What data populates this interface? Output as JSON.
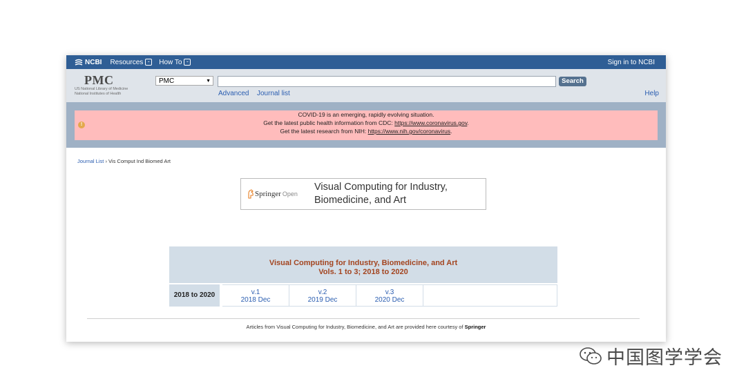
{
  "ncbi_bar": {
    "logo": "NCBI",
    "resources": "Resources",
    "howto": "How To",
    "signin": "Sign in to NCBI"
  },
  "header": {
    "logo": "PMC",
    "nlm_line1": "US National Library of Medicine",
    "nlm_line2": "National Institutes of Health",
    "db_selected": "PMC",
    "search_button": "Search",
    "advanced": "Advanced",
    "journal_list": "Journal list",
    "help": "Help"
  },
  "alert": {
    "line1": "COVID-19 is an emerging, rapidly evolving situation.",
    "line2_prefix": "Get the latest public health information from CDC:",
    "line2_link": "https://www.coronavirus.gov",
    "line2_suffix": ".",
    "line3_prefix": "Get the latest research from NIH:",
    "line3_link": "https://www.nih.gov/coronavirus",
    "line3_suffix": "."
  },
  "breadcrumb": {
    "root": "Journal List",
    "sep": "›",
    "current": "Vis Comput Ind Biomed Art"
  },
  "banner": {
    "publisher": "Springer",
    "publisher_suffix": "Open",
    "journal_line1": "Visual Computing for Industry,",
    "journal_line2": "Biomedicine, and Art"
  },
  "volumes": {
    "title": "Visual Computing for Industry, Biomedicine, and Art",
    "range": "Vols. 1 to 3;  2018 to 2020",
    "year_range": "2018 to 2020",
    "items": [
      {
        "vol": "v.1",
        "date": "2018 Dec"
      },
      {
        "vol": "v.2",
        "date": "2019 Dec"
      },
      {
        "vol": "v.3",
        "date": "2020 Dec"
      }
    ]
  },
  "footer": {
    "text": "Articles from Visual Computing for Industry, Biomedicine, and Art are provided here courtesy of",
    "publisher": "Springer"
  },
  "watermark": {
    "text": "中国图学学会"
  },
  "colors": {
    "ncbi_bar": "#2f5e95",
    "alert_bg": "#ffbcbc",
    "volume_title": "#a3441f",
    "link": "#2a5db0"
  }
}
